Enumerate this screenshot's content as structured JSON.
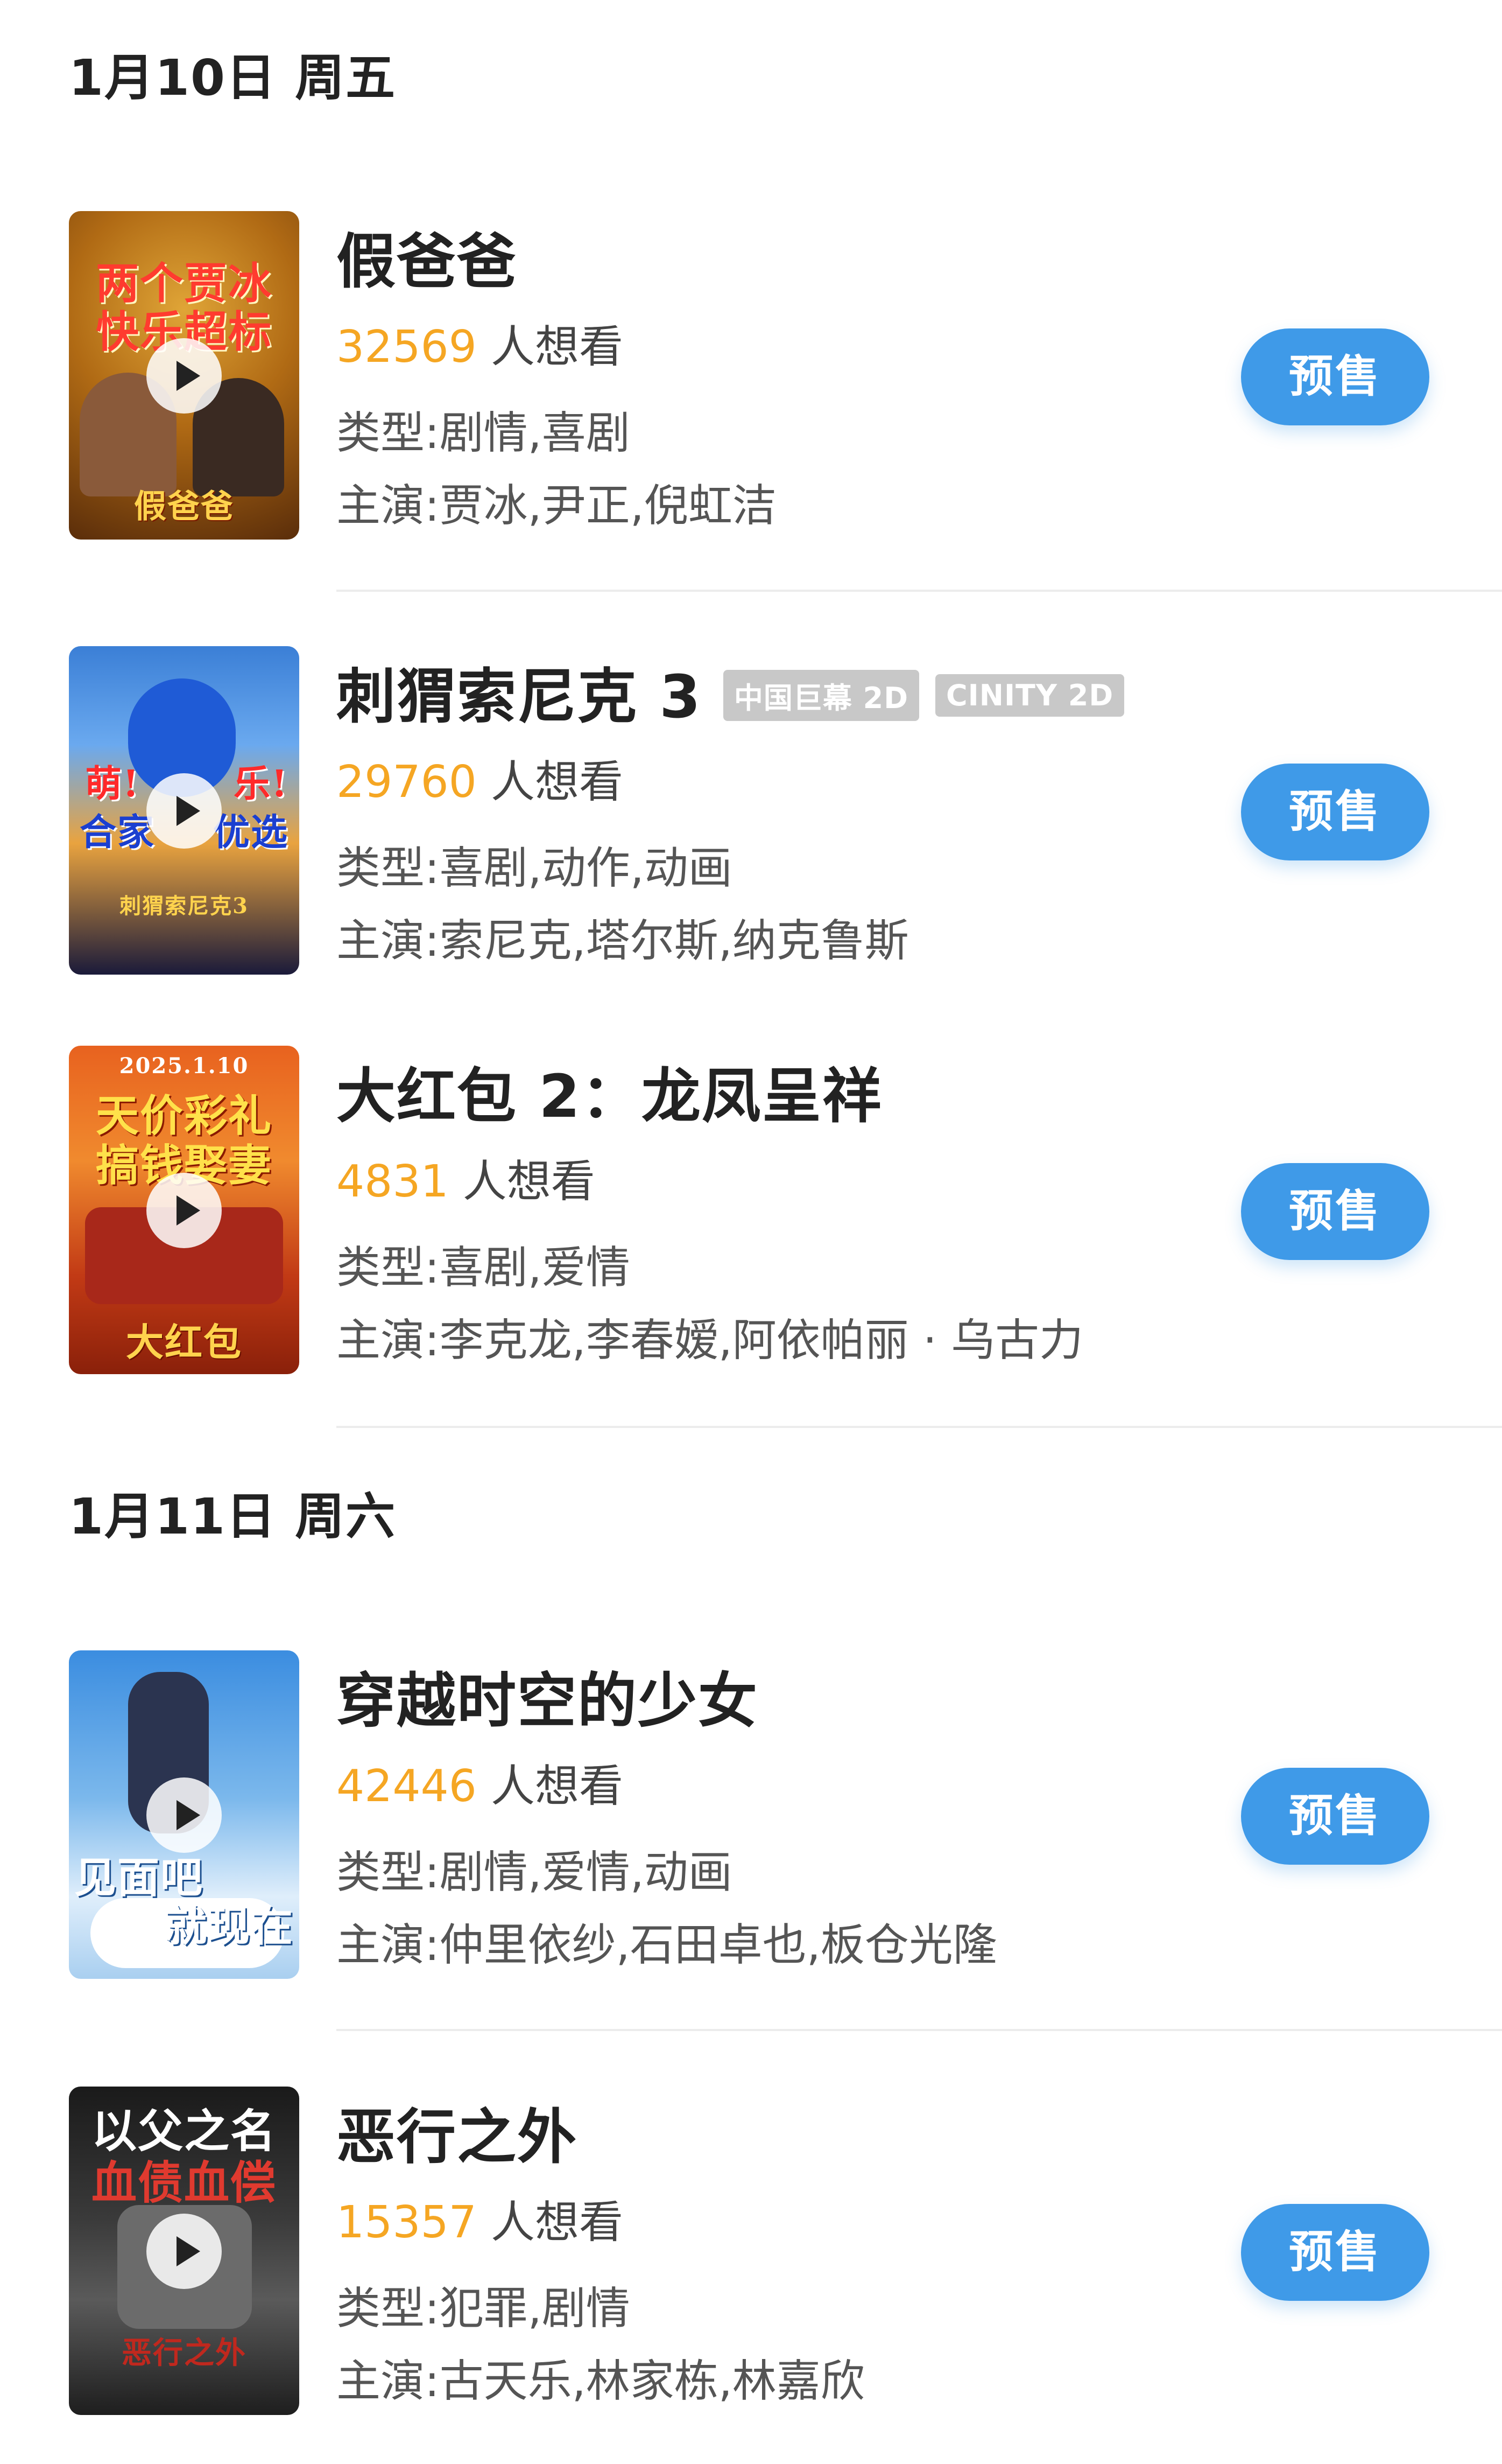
{
  "sections": [
    {
      "date": "1月10日 周五",
      "movies": [
        {
          "title": "假爸爸",
          "tags": [],
          "want_count": "32569",
          "want_suffix": "人想看",
          "genre": "类型:剧情,喜剧",
          "cast": "主演:贾冰,尹正,倪虹洁",
          "button": "预售",
          "poster_text": [
            "两个贾冰",
            "快乐超标",
            "假爸爸"
          ]
        },
        {
          "title": "刺猬索尼克 3",
          "tags": [
            "中国巨幕 2D",
            "CINITY 2D"
          ],
          "want_count": "29760",
          "want_suffix": "人想看",
          "genre": "类型:喜剧,动作,动画",
          "cast": "主演:索尼克,塔尔斯,纳克鲁斯",
          "button": "预售",
          "poster_text": [
            "萌!",
            "乐!",
            "合家",
            "优选",
            "刺猬索尼克3"
          ]
        },
        {
          "title": "大红包 2：龙凤呈祥",
          "tags": [],
          "want_count": "4831",
          "want_suffix": "人想看",
          "genre": "类型:喜剧,爱情",
          "cast": "主演:李克龙,李春嫒,阿依帕丽 · 乌古力",
          "button": "预售",
          "poster_text": [
            "2025.1.10",
            "天价彩礼",
            "搞钱娶妻",
            "大红包"
          ]
        }
      ]
    },
    {
      "date": "1月11日 周六",
      "movies": [
        {
          "title": "穿越时空的少女",
          "tags": [],
          "want_count": "42446",
          "want_suffix": "人想看",
          "genre": "类型:剧情,爱情,动画",
          "cast": "主演:仲里依纱,石田卓也,板仓光隆",
          "button": "预售",
          "poster_text": [
            "见面吧",
            "就现在"
          ]
        },
        {
          "title": "恶行之外",
          "tags": [],
          "want_count": "15357",
          "want_suffix": "人想看",
          "genre": "类型:犯罪,剧情",
          "cast": "主演:古天乐,林家栋,林嘉欣",
          "button": "预售",
          "poster_text": [
            "以父之名",
            "血债血偿",
            "恶行之外"
          ]
        }
      ]
    }
  ]
}
